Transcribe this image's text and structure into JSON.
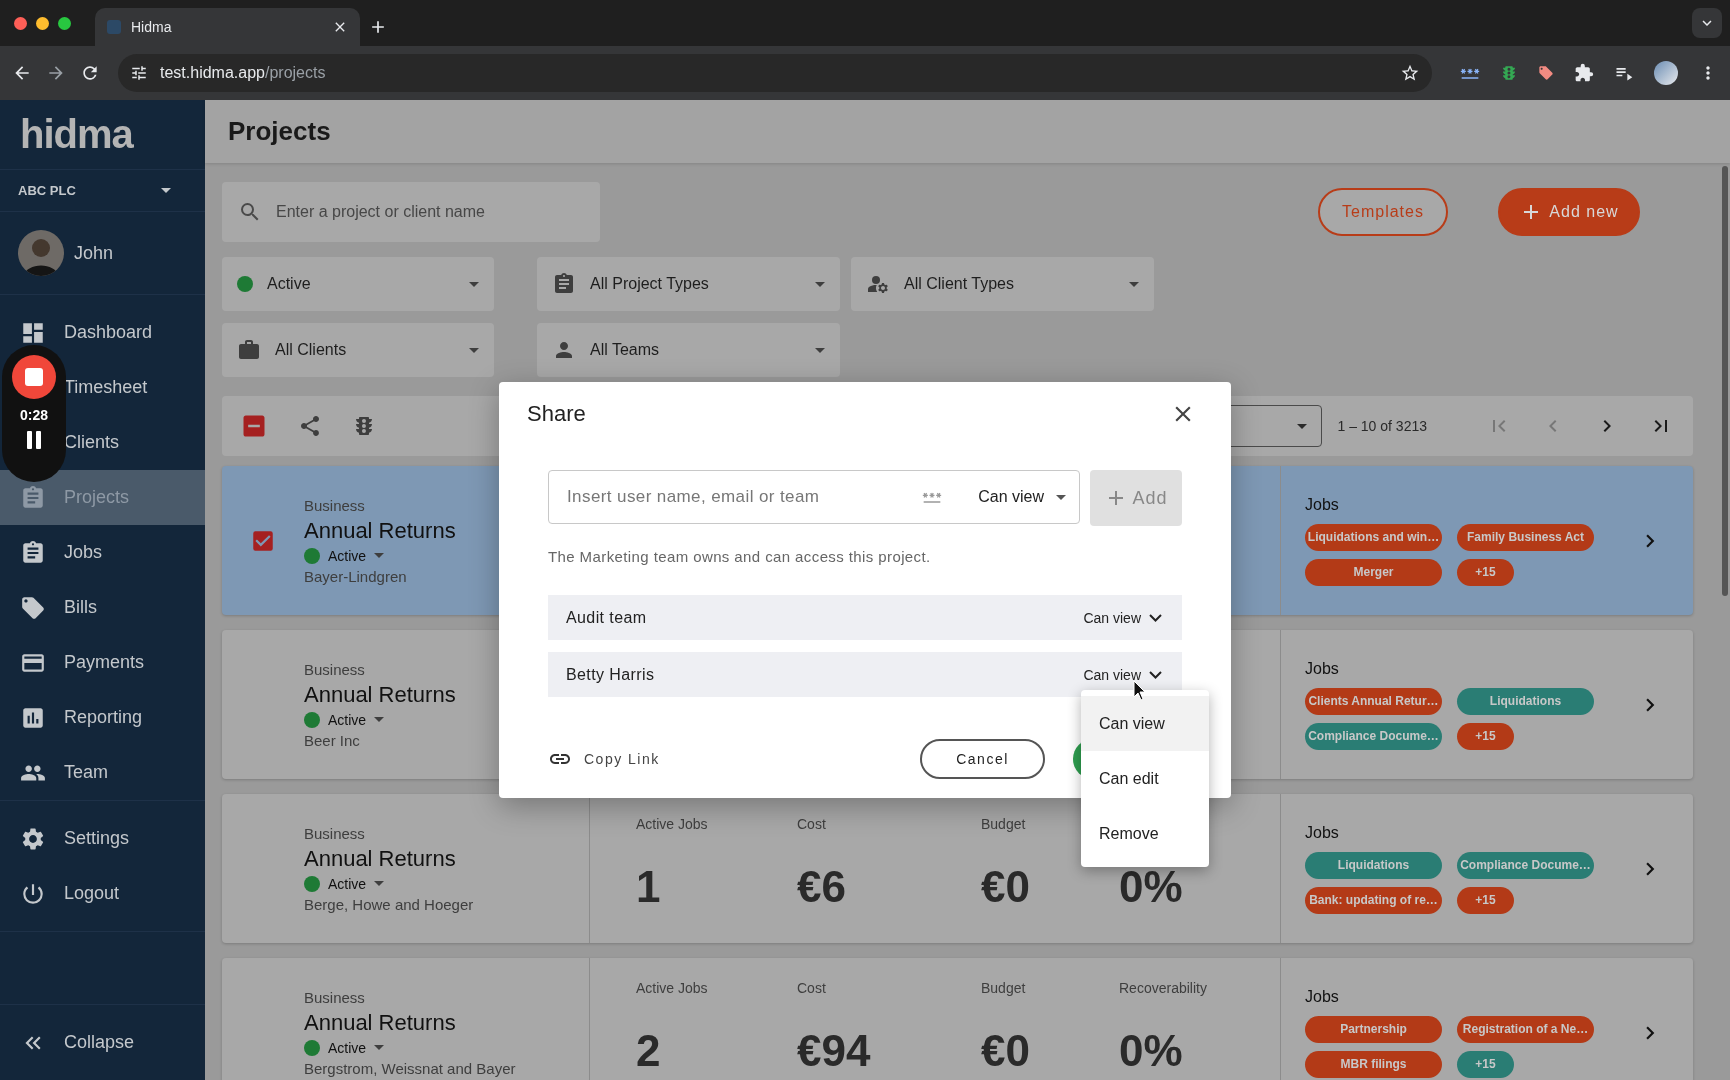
{
  "browser": {
    "tab_title": "Hidma",
    "url_host": "test.hidma.app",
    "url_path": "/projects"
  },
  "sidebar": {
    "logo": "hidma",
    "organization": "ABC PLC",
    "user": "John",
    "nav": [
      {
        "label": "Dashboard",
        "selected": false
      },
      {
        "label": "Timesheet",
        "selected": false
      },
      {
        "label": "Clients",
        "selected": false
      },
      {
        "label": "Projects",
        "selected": true
      },
      {
        "label": "Jobs",
        "selected": false
      },
      {
        "label": "Bills",
        "selected": false
      },
      {
        "label": "Payments",
        "selected": false
      },
      {
        "label": "Reporting",
        "selected": false
      },
      {
        "label": "Team",
        "selected": false
      }
    ],
    "bottom_nav": [
      {
        "label": "Settings",
        "selected": false
      },
      {
        "label": "Logout",
        "selected": false
      }
    ],
    "collapse": "Collapse"
  },
  "recorder": {
    "time": "0:28"
  },
  "page": {
    "title": "Projects",
    "search": {
      "placeholder": "Enter a project or client name"
    },
    "buttons": [
      {
        "label": "Templates",
        "kind": "outline"
      },
      {
        "label": "Add new",
        "kind": "filled"
      }
    ],
    "filters": [
      {
        "label": "Active"
      },
      {
        "label": "All Project Types"
      },
      {
        "label": "All Client Types"
      },
      {
        "label": "All Clients"
      },
      {
        "label": "All Teams"
      }
    ],
    "select_all_partly_checked": true,
    "pagination": "1 – 10 of 3213"
  },
  "projects": [
    {
      "type": "Business",
      "name": "Annual Returns",
      "status": "Active",
      "client": "Bayer-Lindgren",
      "selected": true,
      "jobs_title": "Jobs",
      "jobs": [
        {
          "label": "Liquidations and win…",
          "color": "#b33a17"
        },
        {
          "label": "Family Business Act",
          "color": "#b33a17"
        },
        {
          "label": "Merger",
          "color": "#b33a17"
        },
        {
          "label": "+15",
          "color": "#b33a17"
        }
      ]
    },
    {
      "type": "Business",
      "name": "Annual Returns",
      "status": "Active",
      "client": "Beer Inc",
      "selected": false,
      "jobs_title": "Jobs",
      "jobs": [
        {
          "label": "Clients Annual Retur…",
          "color": "#b33a17"
        },
        {
          "label": "Liquidations",
          "color": "#2a7d74"
        },
        {
          "label": "Compliance Docume…",
          "color": "#2a7d74"
        },
        {
          "label": "+15",
          "color": "#b33a17"
        }
      ]
    },
    {
      "type": "Business",
      "name": "Annual Returns",
      "status": "Active",
      "client": "Berge, Howe and Hoeger",
      "selected": false,
      "stats": [
        {
          "label": "Active Jobs",
          "value": "1"
        },
        {
          "label": "Cost",
          "value": "€6"
        },
        {
          "label": "Budget",
          "value": "€0"
        },
        {
          "value": "0%"
        }
      ],
      "jobs_title": "Jobs",
      "jobs": [
        {
          "label": "Liquidations",
          "color": "#2a7d74"
        },
        {
          "label": "Compliance Docume…",
          "color": "#2a7d74"
        },
        {
          "label": "Bank: updating of re…",
          "color": "#b33a17"
        },
        {
          "label": "+15",
          "color": "#b33a17"
        }
      ]
    },
    {
      "type": "Business",
      "name": "Annual Returns",
      "status": "Active",
      "client": "Bergstrom, Weissnat and Bayer",
      "selected": false,
      "stats": [
        {
          "label": "Active Jobs",
          "value": "2"
        },
        {
          "label": "Cost",
          "value": "€94"
        },
        {
          "label": "Budget",
          "value": "€0"
        },
        {
          "label": "Recoverability",
          "value": "0%"
        }
      ],
      "jobs_title": "Jobs",
      "jobs": [
        {
          "label": "Partnership",
          "color": "#b33a17"
        },
        {
          "label": "Registration of a Ne…",
          "color": "#b33a17"
        },
        {
          "label": "MBR filings",
          "color": "#b33a17"
        },
        {
          "label": "+15",
          "color": "#2a7d74"
        }
      ]
    }
  ],
  "dialog": {
    "title": "Share",
    "input": {
      "placeholder": "Insert user name, email or team"
    },
    "permission": "Can view",
    "add": "Add",
    "note": "The Marketing team owns and can access this project.",
    "members": [
      {
        "name": "Audit team",
        "permission": "Can view"
      },
      {
        "name": "Betty Harris",
        "permission": "Can view"
      }
    ],
    "copy_link": "Copy Link",
    "cancel": "Cancel",
    "menu": [
      {
        "label": "Can view",
        "selected": true
      },
      {
        "label": "Can edit",
        "selected": false
      },
      {
        "label": "Remove",
        "selected": false
      }
    ]
  }
}
